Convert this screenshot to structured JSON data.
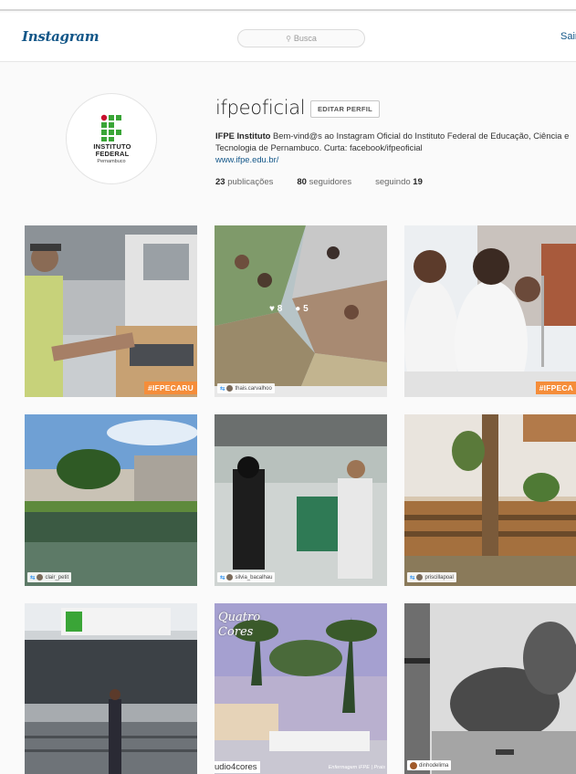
{
  "header": {
    "logo": "Instagram",
    "search_placeholder": "Busca",
    "signout": "Sair"
  },
  "profile": {
    "username": "ifpeoficial",
    "edit_button": "EDITAR PERFIL",
    "avatar_title": "INSTITUTO FEDERAL",
    "avatar_subtitle": "Pernambuco",
    "bio_name": "IFPE Instituto",
    "bio_text": " Bem-vind@s ao Instagram Oficial do Instituto Federal de Educação, Ciência e Tecnologia de Pernambuco. Curta: facebook/ifpeoficial",
    "website": "www.ifpe.edu.br/",
    "posts_count": "23",
    "posts_label": " publicações",
    "followers_count": "80",
    "followers_label": " seguidores",
    "following_label": "seguindo ",
    "following_count": "19"
  },
  "posts": [
    {
      "hashtag": "#IFPECARU"
    },
    {
      "tag": "thais.carvalhoo",
      "likes": "8",
      "comments": "5"
    },
    {
      "hashtag": "#IFPECA"
    },
    {
      "tag": "clair_petit"
    },
    {
      "tag": "silvia_bacalhau"
    },
    {
      "tag": "priscillapoal"
    },
    {},
    {
      "caption": "Quatro Cores",
      "tag": "udio4cores",
      "footer": "Enfermagem IFPE | Prais"
    },
    {
      "tag": "dinhodelima"
    }
  ],
  "colors": {
    "brand_blue": "#125688",
    "hashtag_orange": "#f58d3a",
    "ifpe_green": "#3aa537",
    "ifpe_red": "#c8102e"
  }
}
